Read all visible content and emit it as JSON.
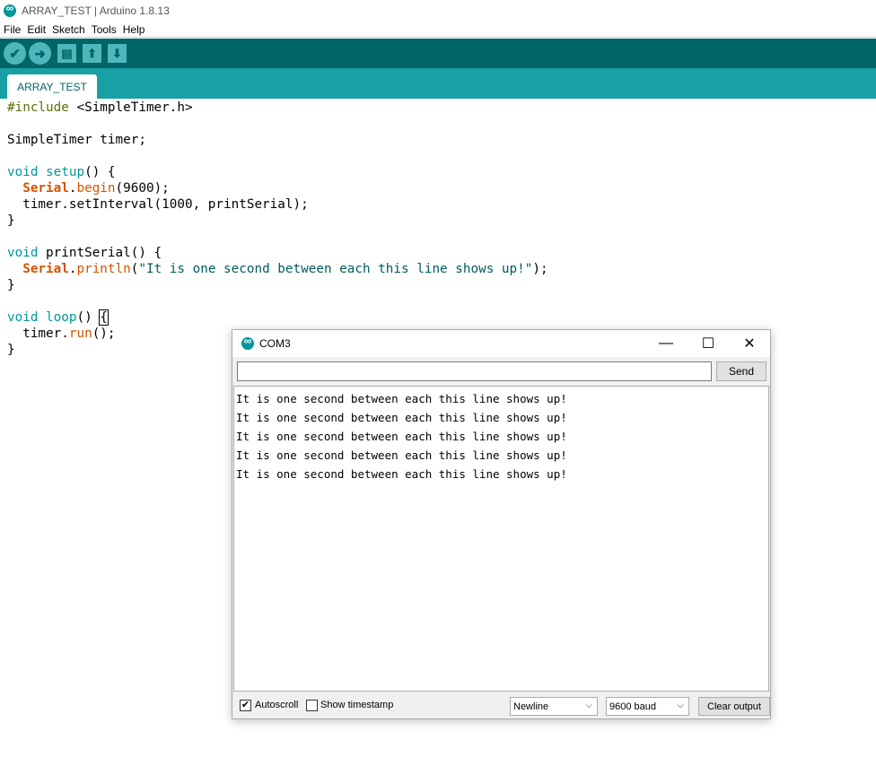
{
  "window": {
    "title": "ARRAY_TEST | Arduino 1.8.13",
    "logo_icon": "arduino-logo-icon"
  },
  "menu": [
    "File",
    "Edit",
    "Sketch",
    "Tools",
    "Help"
  ],
  "toolbar": {
    "verify_icon": "✔",
    "upload_icon": "➜",
    "new_icon": "▤",
    "open_icon": "⬆",
    "save_icon": "⬇"
  },
  "tabs": [
    {
      "label": "ARRAY_TEST"
    }
  ],
  "code": {
    "l1_pre": "#include",
    "l1_rest": " <SimpleTimer.h>",
    "l3": "SimpleTimer timer;",
    "l5_type": "void",
    "l5_fn": "setup",
    "l5_rest": "() {",
    "l6_obj": "Serial",
    "l6_fn": "begin",
    "l6_rest": "(9600);",
    "l7": "  timer.setInterval(1000, printSerial);",
    "l8": "}",
    "l10_type": "void",
    "l10_rest": " printSerial() {",
    "l11_obj": "Serial",
    "l11_fn": "println",
    "l11_str": "\"It is one second between each this line shows up!\"",
    "l11_end": ");",
    "l12": "}",
    "l14_type": "void",
    "l14_fn": "loop",
    "l14_rest": "() ",
    "l14_brace": "{",
    "l15_pre": "  timer.",
    "l15_fn": "run",
    "l15_rest": "();",
    "l16": "}"
  },
  "serial_monitor": {
    "title": "COM3",
    "minimize": "—",
    "maximize": "☐",
    "close": "✕",
    "input_value": "",
    "send_label": "Send",
    "output_lines": [
      "It is one second between each this line shows up!",
      "It is one second between each this line shows up!",
      "It is one second between each this line shows up!",
      "It is one second between each this line shows up!",
      "It is one second between each this line shows up!"
    ],
    "autoscroll_label": "Autoscroll",
    "autoscroll_checked": "✔",
    "timestamp_label": "Show timestamp",
    "line_ending": "Newline",
    "baud": "9600 baud",
    "clear_label": "Clear output"
  }
}
